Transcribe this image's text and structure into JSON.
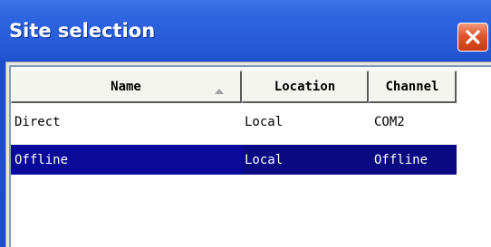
{
  "window": {
    "title": "Site selection",
    "close_icon": "close-icon"
  },
  "colors": {
    "titlebar": "#2a5ad4",
    "close_button": "#e0552d",
    "selection": "#0a0a82",
    "list_background": "#ffffff"
  },
  "table": {
    "columns": [
      {
        "label": "Name",
        "sort": "ascending"
      },
      {
        "label": "Location"
      },
      {
        "label": "Channel"
      }
    ],
    "rows": [
      {
        "name": "Direct",
        "location": "Local",
        "channel": "COM2",
        "selected": false
      },
      {
        "name": "Offline",
        "location": "Local",
        "channel": "Offline",
        "selected": true
      }
    ]
  }
}
